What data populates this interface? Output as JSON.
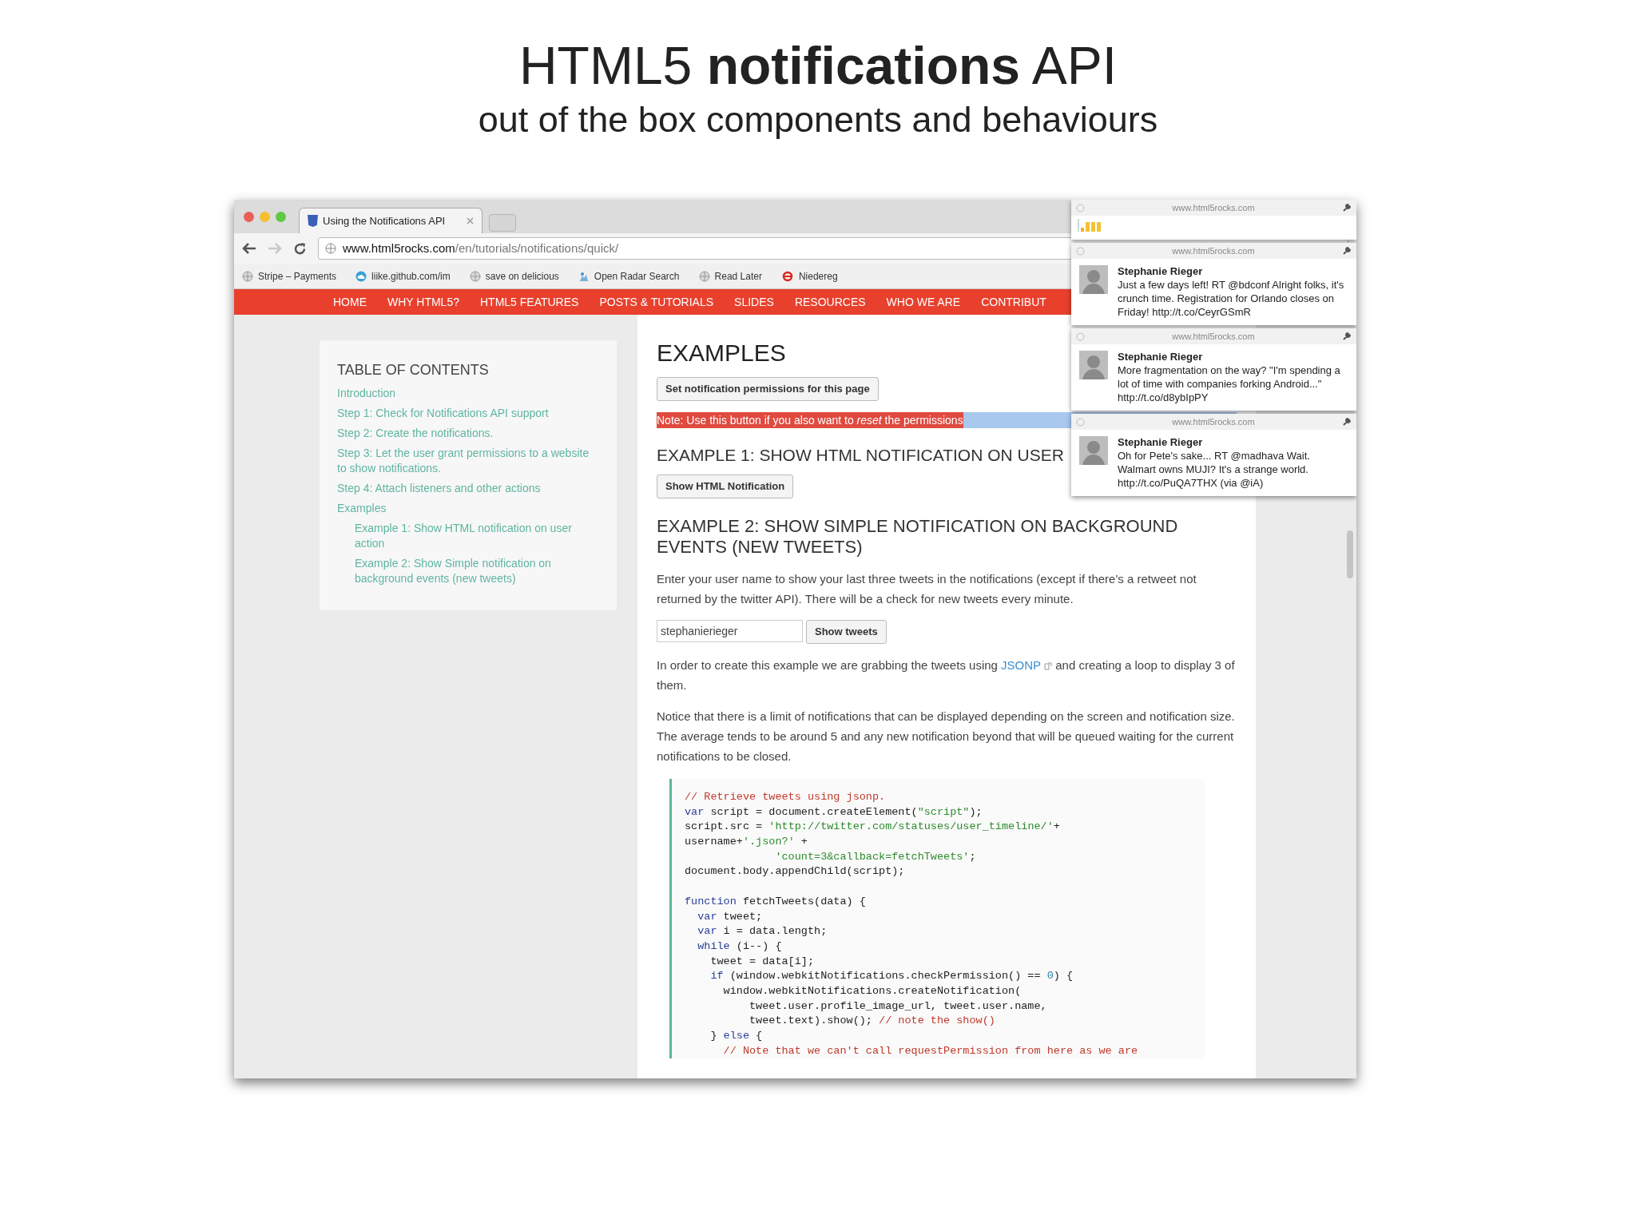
{
  "slide": {
    "title": "HTML5 **notifications** API",
    "subtitle": "out of the box components and behaviours"
  },
  "browser": {
    "tab": {
      "title": "Using the Notifications API",
      "selected": true
    },
    "url": {
      "domain": "www.html5rocks.com",
      "path": "/en/tutorials/notifications/quick/"
    },
    "bookmarks": [
      {
        "label": "Stripe – Payments",
        "kind": "globe"
      },
      {
        "label": "liike.github.com/im",
        "kind": "cloud"
      },
      {
        "label": "save on delicious",
        "kind": "globe"
      },
      {
        "label": "Open Radar Search",
        "kind": "radar"
      },
      {
        "label": "Read Later",
        "kind": "globe"
      },
      {
        "label": "Niedereg",
        "kind": "e"
      }
    ],
    "nav": [
      "HOME",
      "WHY HTML5?",
      "HTML5 FEATURES",
      "POSTS & TUTORIALS",
      "SLIDES",
      "RESOURCES",
      "WHO WE ARE",
      "CONTRIBUT"
    ]
  },
  "toc": {
    "title": "TABLE OF CONTENTS",
    "items": [
      {
        "label": "Introduction"
      },
      {
        "label": "Step 1: Check for Notifications API support"
      },
      {
        "label": "Step 2: Create the notifications."
      },
      {
        "label": "Step 3: Let the user grant permissions to a website to show notifications."
      },
      {
        "label": "Step 4: Attach listeners and other actions"
      },
      {
        "label": "Examples",
        "children": [
          {
            "label": "Example 1: Show HTML notification on user action"
          },
          {
            "label": "Example 2: Show Simple notification on background events (new tweets)"
          }
        ]
      }
    ]
  },
  "main": {
    "heading": "EXAMPLES",
    "permission_button": "Set notification permissions for this page",
    "note": "Note: Use this button if you also want to *reset* the permissions",
    "example1": {
      "heading": "EXAMPLE 1: SHOW HTML NOTIFICATION ON USER",
      "button": "Show HTML Notification"
    },
    "example2": {
      "heading": "EXAMPLE 2: SHOW SIMPLE NOTIFICATION ON BACKGROUND EVENTS (NEW TWEETS)",
      "intro": "Enter your user name to show your last three tweets in the notifications (except if there's a retweet not returned by the twitter API). There will be a check for new tweets every minute.",
      "username": "stephanierieger",
      "button": "Show tweets",
      "jsonp_before": "In order to create this example we are grabbing the tweets using ",
      "jsonp_link": "JSONP",
      "jsonp_after": " and creating a loop to display 3 of them.",
      "notice": "Notice that there is a limit of notifications that can be displayed depending on the screen and notification size. The average tends to be around 5 and any new notification beyond that will be queued waiting for the current notifications to be closed."
    },
    "code": [
      {
        "kind": "code",
        "segments": [
          {
            "kind": "comment",
            "text": "// Retrieve tweets using jsonp."
          }
        ]
      },
      {
        "kind": "code",
        "segments": [
          {
            "kind": "keyword",
            "text": "var"
          },
          {
            "kind": "plain",
            "text": " script = document.createElement("
          },
          {
            "kind": "string",
            "text": "\"script\""
          },
          {
            "kind": "plain",
            "text": ");"
          }
        ]
      },
      {
        "kind": "code",
        "segments": [
          {
            "kind": "plain",
            "text": "script.src = "
          },
          {
            "kind": "string",
            "text": "'http://twitter.com/statuses/user_timeline/'"
          },
          {
            "kind": "plain",
            "text": "+"
          }
        ]
      },
      {
        "kind": "code",
        "segments": [
          {
            "kind": "plain",
            "text": "username+"
          },
          {
            "kind": "string",
            "text": "'.json?'"
          },
          {
            "kind": "plain",
            "text": " +"
          }
        ]
      },
      {
        "kind": "code",
        "segments": [
          {
            "kind": "string",
            "text": "              'count=3&callback=fetchTweets'"
          },
          {
            "kind": "plain",
            "text": ";"
          }
        ]
      },
      {
        "kind": "code",
        "segments": [
          {
            "kind": "plain",
            "text": "document.body.appendChild(script);"
          }
        ]
      },
      {
        "kind": "blank"
      },
      {
        "kind": "code",
        "segments": [
          {
            "kind": "keyword",
            "text": "function"
          },
          {
            "kind": "plain",
            "text": " fetchTweets(data) {"
          }
        ]
      },
      {
        "kind": "code",
        "segments": [
          {
            "kind": "keyword",
            "text": "  var"
          },
          {
            "kind": "plain",
            "text": " tweet;"
          }
        ]
      },
      {
        "kind": "code",
        "segments": [
          {
            "kind": "keyword",
            "text": "  var"
          },
          {
            "kind": "plain",
            "text": " i = data.length;"
          }
        ]
      },
      {
        "kind": "code",
        "segments": [
          {
            "kind": "keyword",
            "text": "  while"
          },
          {
            "kind": "plain",
            "text": " (i--) {"
          }
        ]
      },
      {
        "kind": "code",
        "segments": [
          {
            "kind": "plain",
            "text": "    tweet = data[i];"
          }
        ]
      },
      {
        "kind": "code",
        "segments": [
          {
            "kind": "keyword",
            "text": "    if"
          },
          {
            "kind": "plain",
            "text": " (window.webkitNotifications.checkPermission() == "
          },
          {
            "kind": "number",
            "text": "0"
          },
          {
            "kind": "plain",
            "text": ") {"
          }
        ]
      },
      {
        "kind": "code",
        "segments": [
          {
            "kind": "plain",
            "text": "      window.webkitNotifications.createNotification("
          }
        ]
      },
      {
        "kind": "code",
        "segments": [
          {
            "kind": "plain",
            "text": "          tweet.user.profile_image_url, tweet.user.name,"
          }
        ]
      },
      {
        "kind": "code",
        "segments": [
          {
            "kind": "plain",
            "text": "          tweet.text).show(); "
          },
          {
            "kind": "comment",
            "text": "// note the show()"
          }
        ]
      },
      {
        "kind": "code",
        "segments": [
          {
            "kind": "plain",
            "text": "    } "
          },
          {
            "kind": "keyword",
            "text": "else"
          },
          {
            "kind": "plain",
            "text": " {"
          }
        ]
      },
      {
        "kind": "code",
        "segments": [
          {
            "kind": "comment",
            "text": "      // Note that we can't call requestPermission from here as we are"
          }
        ]
      }
    ]
  },
  "notifications": [
    {
      "kind": "chart",
      "source": "www.html5rocks.com"
    },
    {
      "kind": "tweet",
      "source": "www.html5rocks.com",
      "author": "Stephanie Rieger",
      "text": "Just a few days left! RT @bdconf Alright folks, it's crunch time. Registration for Orlando closes on Friday! http://t.co/CeyrGSmR"
    },
    {
      "kind": "tweet",
      "source": "www.html5rocks.com",
      "author": "Stephanie Rieger",
      "text": "More fragmentation on the way? \"I'm spending a lot of time with companies forking Android...\" http://t.co/d8ybIpPY"
    },
    {
      "kind": "tweet",
      "source": "www.html5rocks.com",
      "author": "Stephanie Rieger",
      "text": "Oh for Pete's sake... RT @madhava Wait. Walmart owns MUJI? It's a strange world. http://t.co/PuQA7THX (via @iA)"
    }
  ]
}
